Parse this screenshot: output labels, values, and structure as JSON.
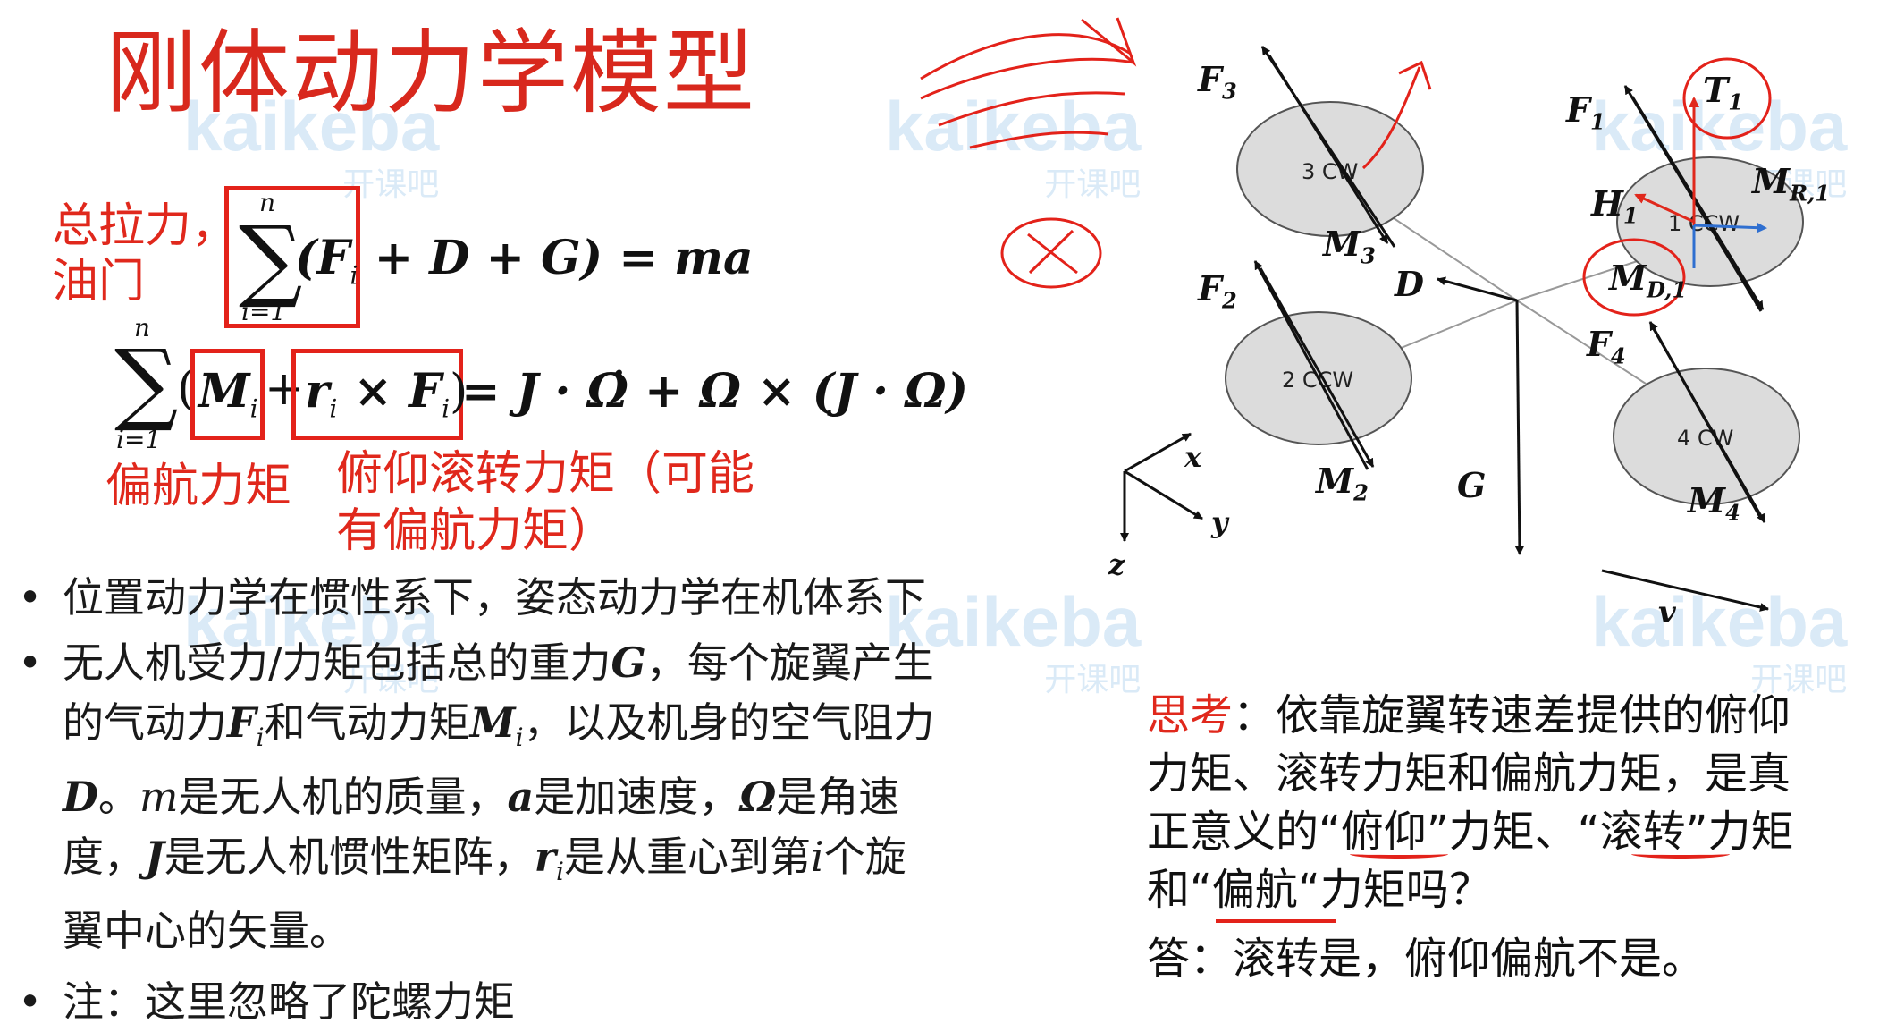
{
  "slide": {
    "title": "刚体动力学模型"
  },
  "equations": {
    "eq1": {
      "sum_upper": "n",
      "sum_lower": "i=1",
      "lhs_rest": "(F",
      "lhs_sub": "i",
      "rhs": " + D + G) = ma"
    },
    "eq2": {
      "sum_upper": "n",
      "sum_lower": "i=1",
      "m_term": "M",
      "m_sub": "i",
      "r_term": "r",
      "r_sub": "i",
      "cross_f": " × F",
      "f_sub": "i",
      "rhs": " = J · Ω̇ + Ω × (J · Ω)"
    }
  },
  "annotations": {
    "thrust_label_line1": "总拉力，",
    "thrust_label_line2": "油门",
    "yaw_moment_label": "偏航力矩",
    "pitch_roll_label_line1": "俯仰滚转力矩（可能",
    "pitch_roll_label_line2": "有偏航力矩）"
  },
  "bullets": [
    {
      "marker": "•",
      "text": "位置动力学在惯性系下，姿态动力学在机体系下"
    },
    {
      "marker": "•",
      "line1": "无人机受力/力矩包括总的重力",
      "G": "G",
      "line1b": "，每个旋翼产生",
      "line2a": "的气动力",
      "Fi": "F",
      "Fi_sub": "i",
      "line2b": "和气动力矩",
      "Mi": "M",
      "Mi_sub": "i",
      "line2c": "，以及机身的空气阻力",
      "D": "D",
      "line3a": "。",
      "m": "m",
      "line3b": "是无人机的质量，",
      "a": "a",
      "line3c": "是加速度，",
      "Omega": "Ω",
      "line3d": "是角速",
      "line4a": "度，",
      "J": "J",
      "line4b": "是无人机惯性矩阵，",
      "ri": "r",
      "ri_sub": "i",
      "line4c": "是从重心到第",
      "i": "i",
      "line4d": "个旋",
      "line5": "翼中心的矢量。"
    },
    {
      "marker": "•",
      "text": "注：这里忽略了陀螺力矩"
    }
  ],
  "diagram": {
    "rotors": [
      {
        "label": "3 CW"
      },
      {
        "label": "1 CCW"
      },
      {
        "label": "2 CCW"
      },
      {
        "label": "4 CW"
      }
    ],
    "labels": {
      "F3": "F",
      "F3_sub": "3",
      "F1": "F",
      "F1_sub": "1",
      "F2": "F",
      "F2_sub": "2",
      "F4": "F",
      "F4_sub": "4",
      "T1": "T",
      "T1_sub": "1",
      "M3": "M",
      "M3_sub": "3",
      "M2": "M",
      "M2_sub": "2",
      "M4": "M",
      "M4_sub": "4",
      "MR1": "M",
      "MR1_sub": "R,1",
      "MD1": "M",
      "MD1_sub": "D,1",
      "H1": "H",
      "H1_sub": "1",
      "D": "D",
      "G": "G",
      "x": "x",
      "y": "y",
      "z": "z",
      "v": "v"
    }
  },
  "think": {
    "label": "思考",
    "text_line1": "：依靠旋翼转速差提供的俯仰",
    "text_line2": "力矩、滚转力矩和偏航力矩，是真",
    "text_line3": "正意义的“俯仰”力矩、“滚转”力矩",
    "text_line4": "和“偏航“力矩吗？",
    "answer": "答：滚转是，俯仰偏航不是。"
  },
  "watermark": {
    "brand": "kaikeba",
    "sub": "开课吧"
  },
  "colors": {
    "accent_red": "#e0281c",
    "rotor_fill": "#dcdcdc",
    "watermark_blue": "#4696d7",
    "diagram_blue": "#2f6fd0"
  }
}
